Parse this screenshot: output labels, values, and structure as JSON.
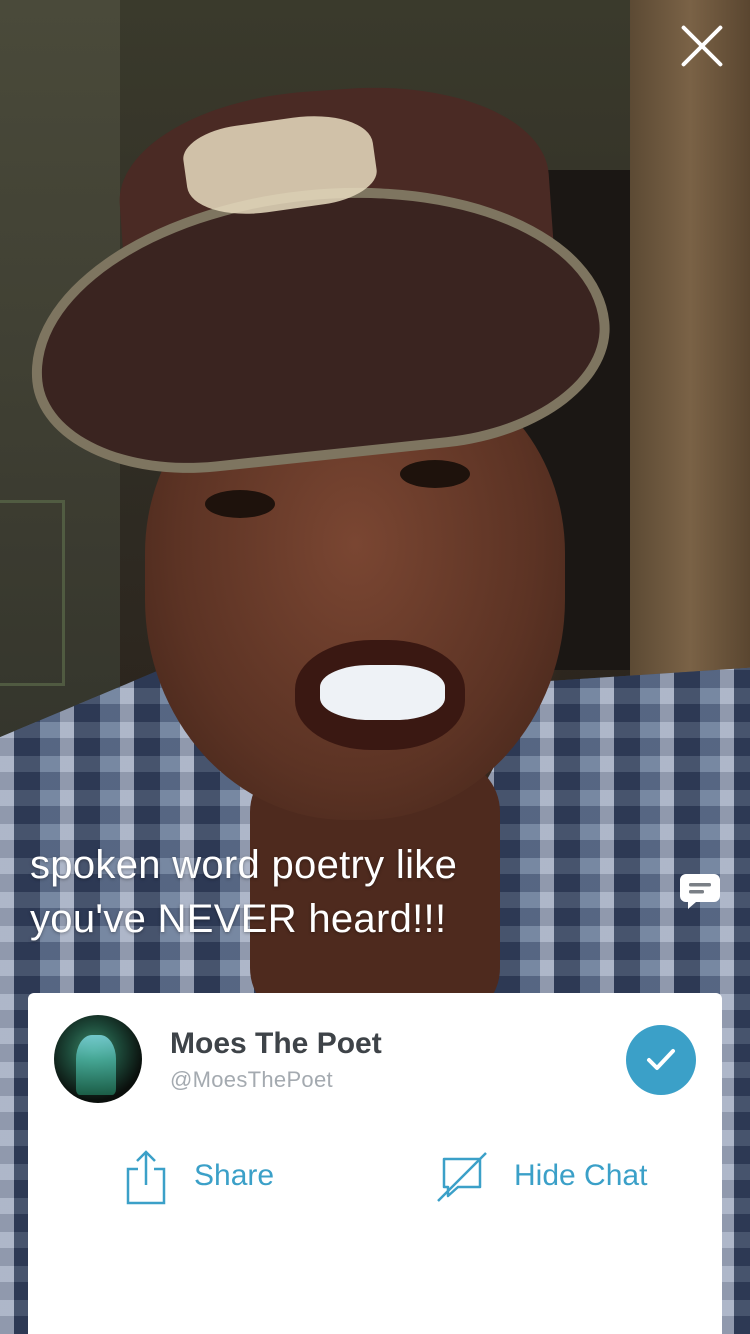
{
  "broadcast": {
    "caption_line1": "spoken word poetry like",
    "caption_line2": "you've NEVER heard!!!"
  },
  "broadcaster": {
    "name": "Moes The Poet",
    "handle": "@MoesThePoet",
    "following": true
  },
  "actions": {
    "share_label": "Share",
    "hide_chat_label": "Hide Chat"
  },
  "icons": {
    "close": "close-icon",
    "chat": "chat-bubble-icon",
    "follow": "checkmark-icon",
    "share": "share-icon",
    "hide_chat": "hide-chat-icon"
  },
  "colors": {
    "accent": "#3ba0c8",
    "name_text": "#3e4348",
    "handle_text": "#a4aab0"
  }
}
